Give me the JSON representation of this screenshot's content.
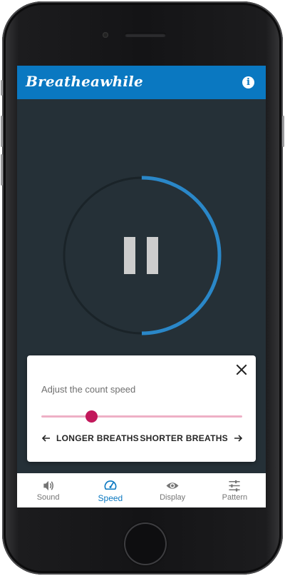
{
  "app": {
    "title": "Breatheawhile",
    "info_icon": "info-icon",
    "accent_color": "#0a78c1"
  },
  "timer": {
    "progress": 0.5,
    "ring_color": "#2a87c8",
    "state_icon": "pause-icon"
  },
  "speed_sheet": {
    "label": "Adjust the count speed",
    "slider_value": 0.25,
    "slider_color": "#c2185b",
    "longer_label": "LONGER BREATHS",
    "shorter_label": "SHORTER BREATHS",
    "close_icon": "close-icon"
  },
  "nav": {
    "items": [
      {
        "label": "Sound",
        "icon": "volume-icon",
        "active": false
      },
      {
        "label": "Speed",
        "icon": "speedometer-icon",
        "active": true
      },
      {
        "label": "Display",
        "icon": "eye-icon",
        "active": false
      },
      {
        "label": "Pattern",
        "icon": "sliders-icon",
        "active": false
      }
    ]
  }
}
